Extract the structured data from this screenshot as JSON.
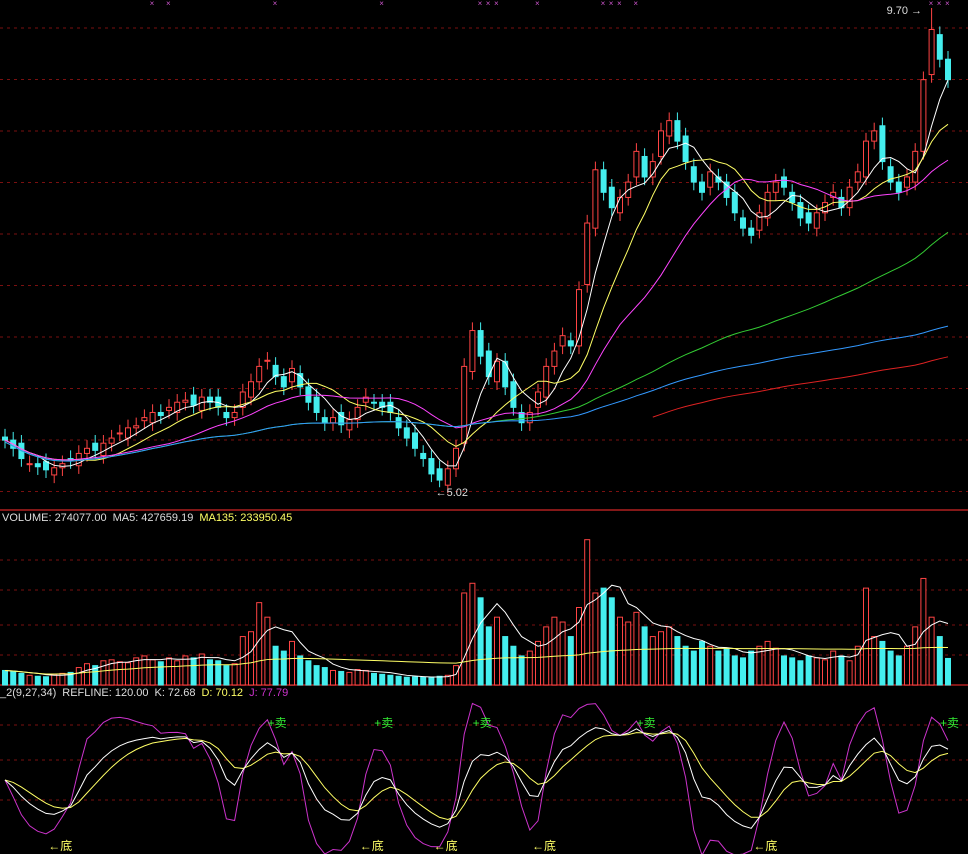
{
  "chart_data": {
    "type": "candlestick",
    "main": {
      "high_label": "9.70",
      "low_label": "5.02",
      "high_index": 113,
      "low_index": 53,
      "closes": [
        5.48,
        5.4,
        5.3,
        5.25,
        5.22,
        5.19,
        5.21,
        5.25,
        5.28,
        5.35,
        5.4,
        5.38,
        5.45,
        5.5,
        5.55,
        5.6,
        5.62,
        5.7,
        5.75,
        5.72,
        5.8,
        5.85,
        5.87,
        5.82,
        5.9,
        5.85,
        5.8,
        5.7,
        5.75,
        5.95,
        6.05,
        6.2,
        6.26,
        6.1,
        6.0,
        6.18,
        6.0,
        5.85,
        5.75,
        5.65,
        5.7,
        5.63,
        5.68,
        5.8,
        5.9,
        5.85,
        5.8,
        5.75,
        5.6,
        5.5,
        5.4,
        5.3,
        5.15,
        5.09,
        5.2,
        5.4,
        6.2,
        6.55,
        6.3,
        6.1,
        6.25,
        6.0,
        5.8,
        5.65,
        5.75,
        5.95,
        6.2,
        6.35,
        6.5,
        6.4,
        6.95,
        7.6,
        8.12,
        7.9,
        7.75,
        7.85,
        8.0,
        8.3,
        8.05,
        8.2,
        8.5,
        8.6,
        8.4,
        8.2,
        8.0,
        7.9,
        8.1,
        8.0,
        7.85,
        7.7,
        7.55,
        7.48,
        7.7,
        7.9,
        8.0,
        7.95,
        7.8,
        7.65,
        7.6,
        7.7,
        7.8,
        7.9,
        7.75,
        7.95,
        8.1,
        8.4,
        8.5,
        8.2,
        8.0,
        7.9,
        8.05,
        8.3,
        9.0,
        9.49,
        9.2,
        9.0
      ],
      "top_markers": [
        18,
        20,
        33,
        46,
        58,
        59,
        60,
        65,
        73,
        74,
        75,
        77,
        113,
        114,
        115
      ],
      "ma_periods": [
        5,
        10,
        20,
        60,
        135
      ],
      "ma_colors": [
        "#ffffff",
        "#ffff66",
        "#ff44ff",
        "#33cc33",
        "#3399ff"
      ],
      "ma_long_color": "#dd2222"
    },
    "volume": {
      "label": "VOLUME: 274077.00",
      "ma5_label": "MA5: 427659.19",
      "ma135_label": "MA135: 233950.45",
      "unit": "thousands",
      "values": [
        150,
        140,
        120,
        100,
        90,
        85,
        110,
        120,
        130,
        180,
        220,
        200,
        250,
        260,
        240,
        230,
        280,
        300,
        260,
        240,
        280,
        250,
        300,
        280,
        320,
        260,
        250,
        200,
        220,
        500,
        550,
        850,
        700,
        400,
        350,
        450,
        300,
        250,
        200,
        180,
        150,
        140,
        130,
        160,
        150,
        120,
        110,
        100,
        90,
        80,
        85,
        80,
        75,
        90,
        100,
        200,
        950,
        1050,
        900,
        600,
        700,
        500,
        400,
        300,
        350,
        450,
        600,
        700,
        650,
        500,
        800,
        1500,
        950,
        1000,
        900,
        700,
        650,
        750,
        600,
        500,
        550,
        600,
        500,
        400,
        350,
        450,
        400,
        350,
        380,
        300,
        280,
        350,
        400,
        450,
        380,
        300,
        280,
        250,
        300,
        280,
        260,
        350,
        300,
        250,
        400,
        1000,
        500,
        450,
        350,
        300,
        400,
        600,
        1100,
        700,
        500,
        274
      ]
    },
    "kdj": {
      "label_prefix": "_2(9,27,34)",
      "refline_label": "REFLINE: 120.00",
      "k_label": "K: 72.68",
      "d_label": "D: 70.12",
      "j_label": "J: 77.79",
      "colors": {
        "k": "#ffffff",
        "d": "#ffff66",
        "j": "#cc33cc"
      },
      "sell_text": "卖",
      "bottom_text": "底",
      "sell_indices": [
        33,
        46,
        58,
        78,
        115
      ],
      "bottom_indices": [
        6,
        44,
        53,
        65,
        92
      ]
    }
  }
}
